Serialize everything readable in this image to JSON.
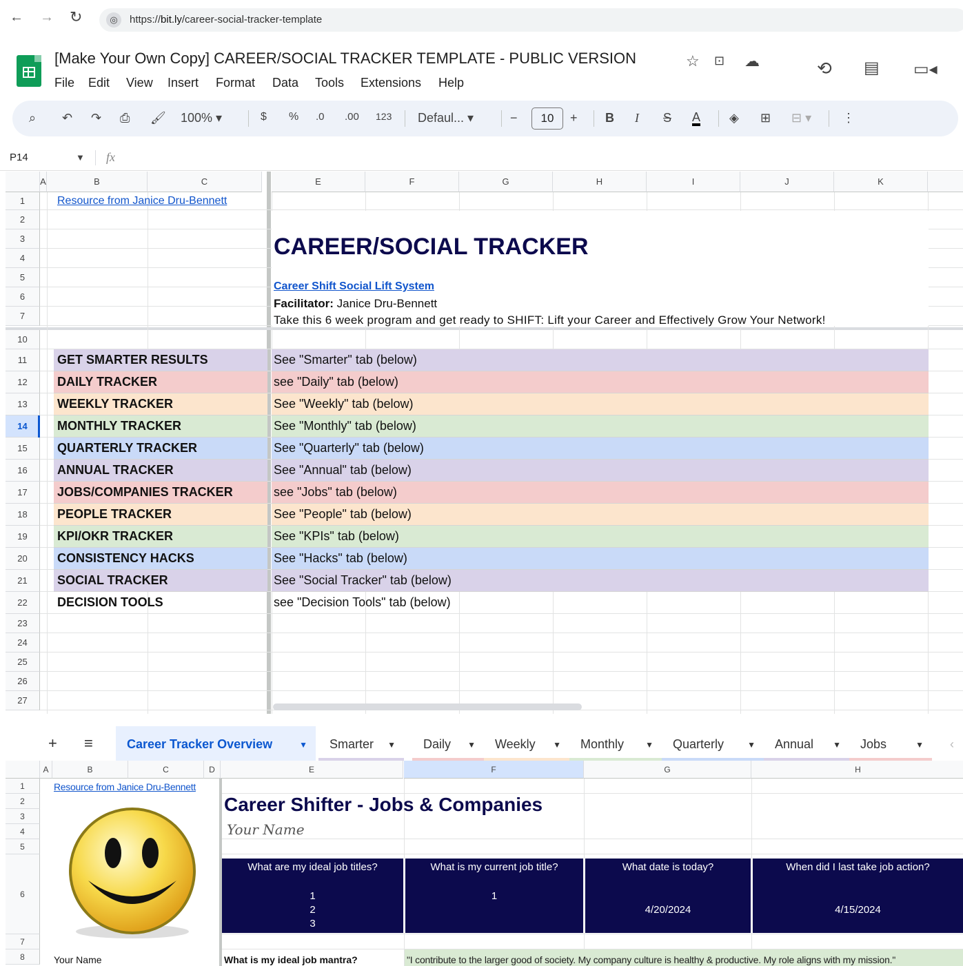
{
  "browser": {
    "url_prefix": "https://",
    "url_host": "bit.ly",
    "url_path": "/career-social-tracker-template"
  },
  "doc": {
    "title": "[Make Your Own Copy] CAREER/SOCIAL TRACKER TEMPLATE - PUBLIC VERSION",
    "menus": [
      "File",
      "Edit",
      "View",
      "Insert",
      "Format",
      "Data",
      "Tools",
      "Extensions",
      "Help"
    ]
  },
  "toolbar": {
    "zoom": "100%",
    "currency": "$",
    "percent": "%",
    "dec_decrease": ".0",
    "dec_increase": ".00",
    "number_format": "123",
    "font": "Defaul...",
    "font_size": "10"
  },
  "formula": {
    "cell_ref": "P14",
    "fx": "fx"
  },
  "sheet1": {
    "columns": [
      "A",
      "B",
      "C",
      "E",
      "F",
      "G",
      "H",
      "I",
      "J",
      "K"
    ],
    "rows": [
      "1",
      "2",
      "3",
      "4",
      "5",
      "6",
      "7",
      "10",
      "11",
      "12",
      "13",
      "14",
      "15",
      "16",
      "17",
      "18",
      "19",
      "20",
      "21",
      "22",
      "23",
      "24",
      "25",
      "26",
      "27"
    ],
    "resource_link": "Resource from Janice Dru-Bennett",
    "title": "CAREER/SOCIAL TRACKER",
    "subtitle_link": "Career Shift Social Lift System",
    "facilitator_label": "Facilitator:",
    "facilitator_name": " Janice Dru-Bennett",
    "tagline": "Take this 6 week program and get ready to SHIFT: Lift your Career and Effectively Grow Your Network!",
    "items": [
      {
        "label": "GET SMARTER RESULTS",
        "value": "See \"Smarter\" tab (below)",
        "color": "#d9d2e9"
      },
      {
        "label": "DAILY TRACKER",
        "value": "see \"Daily\" tab (below)",
        "color": "#f4cccc"
      },
      {
        "label": "WEEKLY TRACKER",
        "value": "See \"Weekly\" tab (below)",
        "color": "#fce5cd"
      },
      {
        "label": "MONTHLY TRACKER",
        "value": "See \"Monthly\" tab (below)",
        "color": "#d9ead3"
      },
      {
        "label": "QUARTERLY TRACKER",
        "value": "See \"Quarterly\" tab (below)",
        "color": "#c9daf8"
      },
      {
        "label": "ANNUAL TRACKER",
        "value": "See \"Annual\" tab (below)",
        "color": "#d9d2e9"
      },
      {
        "label": "JOBS/COMPANIES TRACKER",
        "value": "see \"Jobs\" tab (below)",
        "color": "#f4cccc"
      },
      {
        "label": "PEOPLE TRACKER",
        "value": "See \"People\" tab (below)",
        "color": "#fce5cd"
      },
      {
        "label": "KPI/OKR TRACKER",
        "value": "See \"KPIs\" tab (below)",
        "color": "#d9ead3"
      },
      {
        "label": "CONSISTENCY HACKS",
        "value": "See \"Hacks\" tab (below)",
        "color": "#c9daf8"
      },
      {
        "label": "SOCIAL TRACKER",
        "value": "See \"Social Tracker\" tab (below)",
        "color": "#d9d2e9"
      },
      {
        "label": "DECISION TOOLS",
        "value": "see \"Decision Tools\" tab (below)",
        "color": "#ffffff"
      }
    ]
  },
  "tabs": {
    "add": "+",
    "list": "≡",
    "items": [
      {
        "label": "Career Tracker Overview",
        "color": "#e8f0fe",
        "active": true
      },
      {
        "label": "Smarter",
        "color": "#d9d2e9"
      },
      {
        "label": "Daily",
        "color": "#f4cccc"
      },
      {
        "label": "Weekly",
        "color": "#fce5cd"
      },
      {
        "label": "Monthly",
        "color": "#d9ead3"
      },
      {
        "label": "Quarterly",
        "color": "#c9daf8"
      },
      {
        "label": "Annual",
        "color": "#d9d2e9"
      },
      {
        "label": "Jobs",
        "color": "#f4cccc"
      }
    ]
  },
  "sheet2": {
    "columns": [
      "A",
      "B",
      "C",
      "D",
      "E",
      "F",
      "G",
      "H"
    ],
    "rows": [
      "1",
      "2",
      "3",
      "4",
      "5",
      "6",
      "7",
      "8"
    ],
    "resource_link": "Resource from Janice Dru-Bennett",
    "title": "Career Shifter - Jobs & Companies",
    "your_name_script": "Your Name",
    "headers": [
      {
        "q": "What are my ideal job titles?",
        "a": [
          "1",
          "2",
          "3"
        ]
      },
      {
        "q": "What is my current job title?",
        "a": [
          "1"
        ]
      },
      {
        "q": "What date is today?",
        "a": [
          "4/20/2024"
        ]
      },
      {
        "q": "When did I last take job action?",
        "a": [
          "4/15/2024"
        ]
      }
    ],
    "name_label": "Your Name",
    "mantra_label": "What is my ideal job mantra?",
    "mantra": "\"I contribute to the larger good of society. My company culture is healthy & productive. My role aligns with my mission.\""
  }
}
